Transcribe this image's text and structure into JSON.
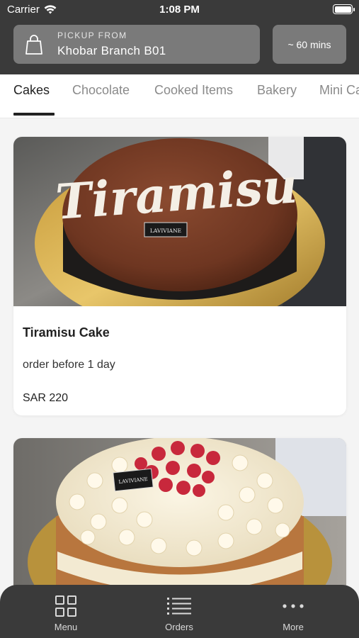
{
  "status_bar": {
    "carrier": "Carrier",
    "time": "1:08 PM"
  },
  "header": {
    "pickup_label": "PICKUP FROM",
    "branch": "Khobar Branch B01",
    "eta": "~ 60 mins"
  },
  "tabs": [
    {
      "label": "Cakes",
      "active": true
    },
    {
      "label": "Chocolate",
      "active": false
    },
    {
      "label": "Cooked Items",
      "active": false
    },
    {
      "label": "Bakery",
      "active": false
    },
    {
      "label": "Mini Ca",
      "active": false
    }
  ],
  "products": [
    {
      "name": "Tiramisu Cake",
      "note": "order before 1 day",
      "price": "SAR 220",
      "photo_text": "Tiramisu",
      "badge_text": "LAVIVIANE"
    },
    {
      "badge_text": "LAVIVIANE"
    }
  ],
  "bottom_nav": [
    {
      "label": "Menu",
      "icon": "grid-icon"
    },
    {
      "label": "Orders",
      "icon": "list-icon"
    },
    {
      "label": "More",
      "icon": "more-dots-icon"
    }
  ]
}
